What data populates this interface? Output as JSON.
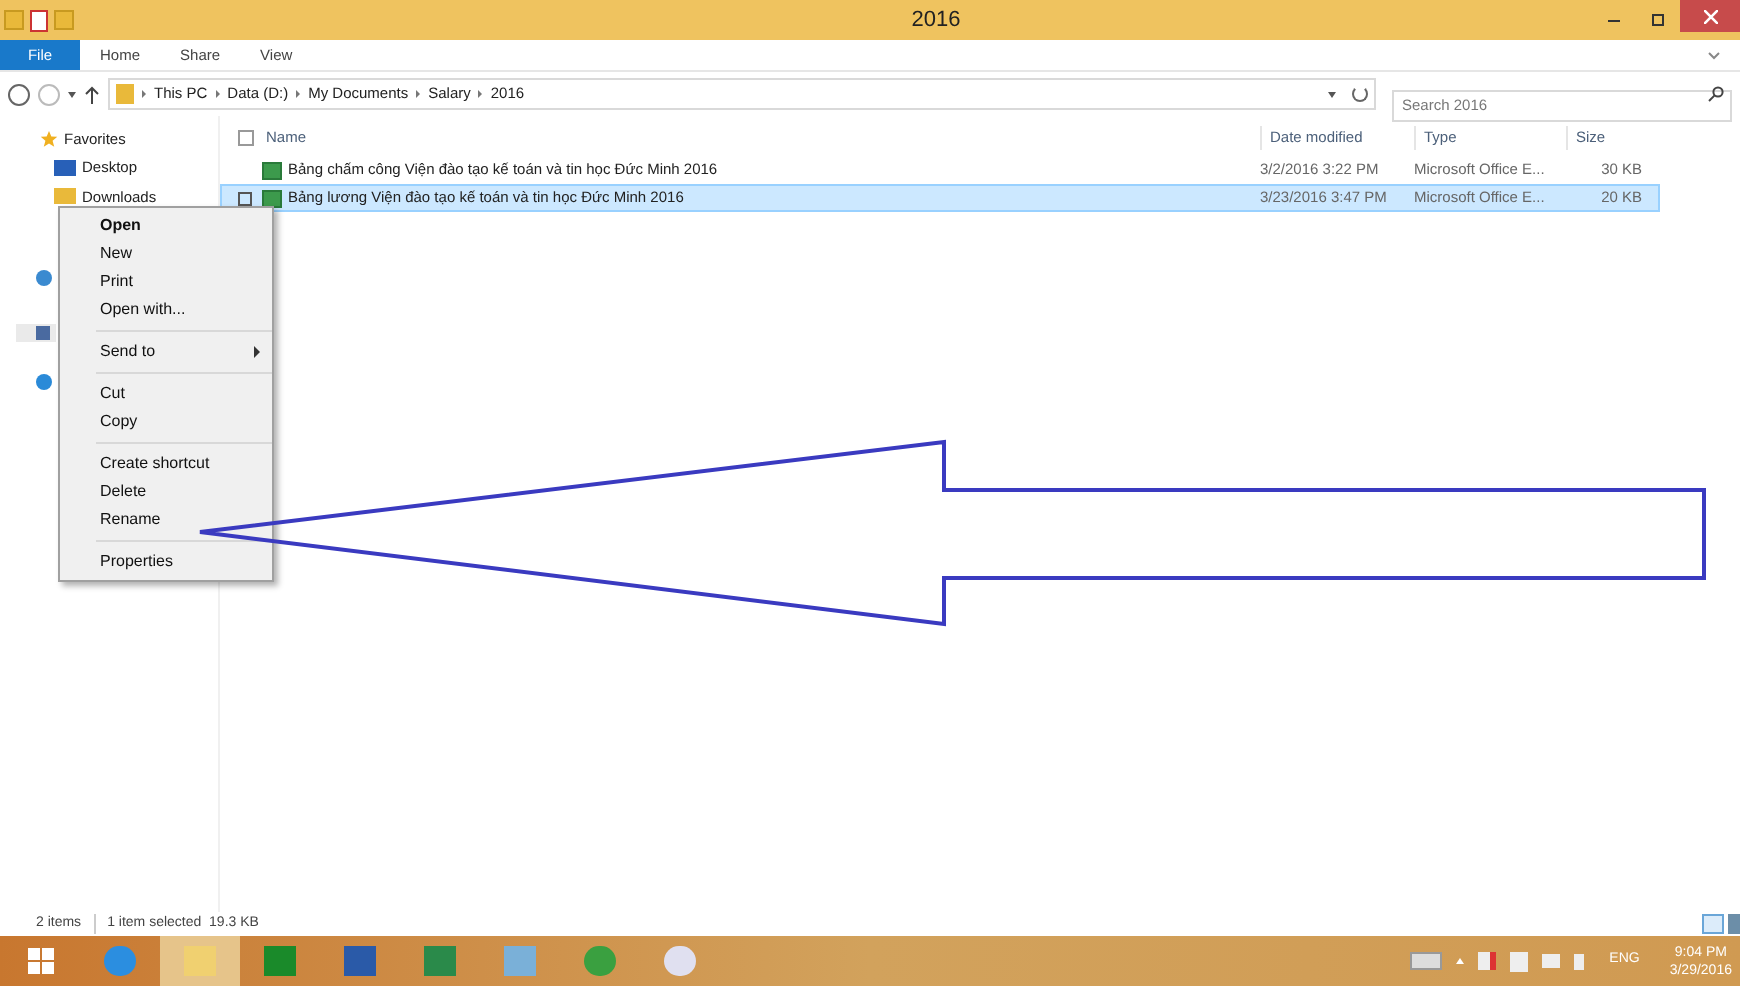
{
  "window": {
    "title": "2016"
  },
  "ribbon_tabs": [
    {
      "label": "File",
      "selected": true
    },
    {
      "label": "Home",
      "selected": false
    },
    {
      "label": "Share",
      "selected": false
    },
    {
      "label": "View",
      "selected": false
    }
  ],
  "breadcrumb": [
    "This PC",
    "Data (D:)",
    "My Documents",
    "Salary",
    "2016"
  ],
  "search": {
    "placeholder": "Search 2016"
  },
  "sidebar": {
    "items": [
      {
        "label": "Favorites",
        "kind": "header"
      },
      {
        "label": "Desktop",
        "kind": "item"
      },
      {
        "label": "Downloads",
        "kind": "item"
      }
    ]
  },
  "table": {
    "select_all": {
      "checked": false
    },
    "columns": [
      "Name",
      "Date modified",
      "Type",
      "Size"
    ],
    "rows": [
      {
        "name": "Bảng chấm công Viện đào tạo kế toán và tin học Đức Minh 2016",
        "date": "3/2/2016 3:22 PM",
        "type": "Microsoft Office E...",
        "size": "30 KB",
        "selected": false
      },
      {
        "name": "Bảng lương Viện đào tạo kế toán và tin học Đức Minh 2016",
        "date": "3/23/2016 3:47 PM",
        "type": "Microsoft Office E...",
        "size": "20 KB",
        "selected": true
      }
    ]
  },
  "context_menu": [
    {
      "kind": "item",
      "label": "Open",
      "default": true
    },
    {
      "kind": "item",
      "label": "New",
      "default": false
    },
    {
      "kind": "item",
      "label": "Print",
      "default": false
    },
    {
      "kind": "item",
      "label": "Open with...",
      "default": false
    },
    {
      "kind": "separator"
    },
    {
      "kind": "submenu",
      "label": "Send to",
      "default": false
    },
    {
      "kind": "separator"
    },
    {
      "kind": "item",
      "label": "Cut",
      "default": false
    },
    {
      "kind": "item",
      "label": "Copy",
      "default": false
    },
    {
      "kind": "separator"
    },
    {
      "kind": "item",
      "label": "Create shortcut",
      "default": false
    },
    {
      "kind": "item",
      "label": "Delete",
      "default": false
    },
    {
      "kind": "item",
      "label": "Rename",
      "default": false
    },
    {
      "kind": "separator"
    },
    {
      "kind": "item",
      "label": "Properties",
      "default": false
    }
  ],
  "status_bar": {
    "count": "2 items",
    "selection": "1 item selected  19.3 KB"
  },
  "taskbar": {
    "language": "ENG",
    "time": "9:04 PM",
    "date": "3/29/2016"
  }
}
